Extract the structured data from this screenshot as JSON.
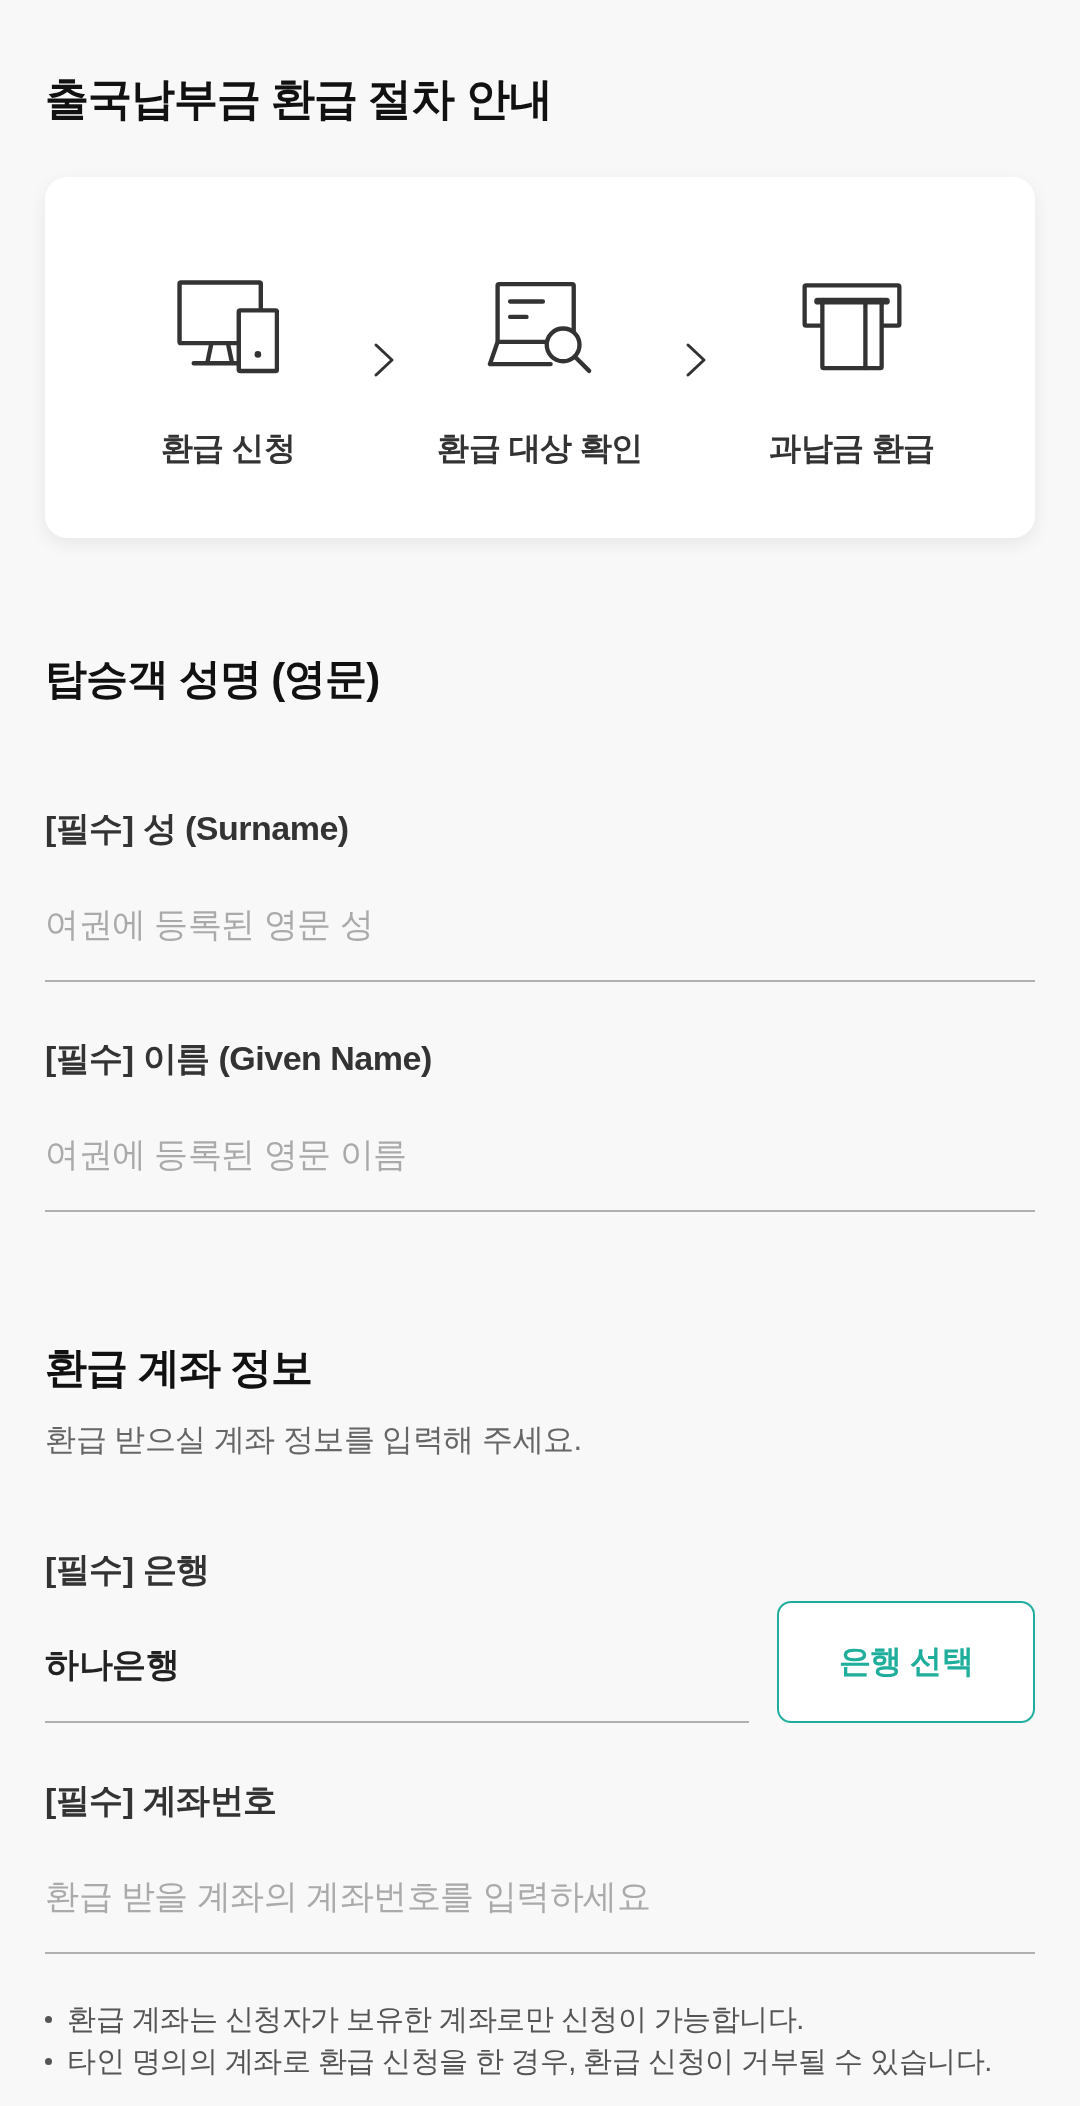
{
  "title": "출국납부금 환급 절차 안내",
  "steps": [
    {
      "label": "환급 신청"
    },
    {
      "label": "환급 대상 확인"
    },
    {
      "label": "과납금 환급"
    }
  ],
  "passenger_name": {
    "title": "탑승객 성명 (영문)",
    "fields": [
      {
        "label": "[필수] 성 (Surname)",
        "placeholder": "여권에 등록된 영문 성"
      },
      {
        "label": "[필수] 이름 (Given Name)",
        "placeholder": "여권에 등록된 영문 이름"
      }
    ]
  },
  "refund_account": {
    "title": "환급 계좌 정보",
    "description": "환급 받으실 계좌 정보를 입력해 주세요.",
    "bank": {
      "label": "[필수] 은행",
      "value": "하나은행",
      "button": "은행 선택"
    },
    "account_number": {
      "label": "[필수] 계좌번호",
      "placeholder": "환급 받을 계좌의 계좌번호를 입력하세요"
    },
    "notes": [
      "환급 계좌는 신청자가 보유한 계좌로만 신청이 가능합니다.",
      "타인 명의의 계좌로 환급 신청을 한 경우, 환급 신청이 거부될 수 있습니다."
    ]
  }
}
